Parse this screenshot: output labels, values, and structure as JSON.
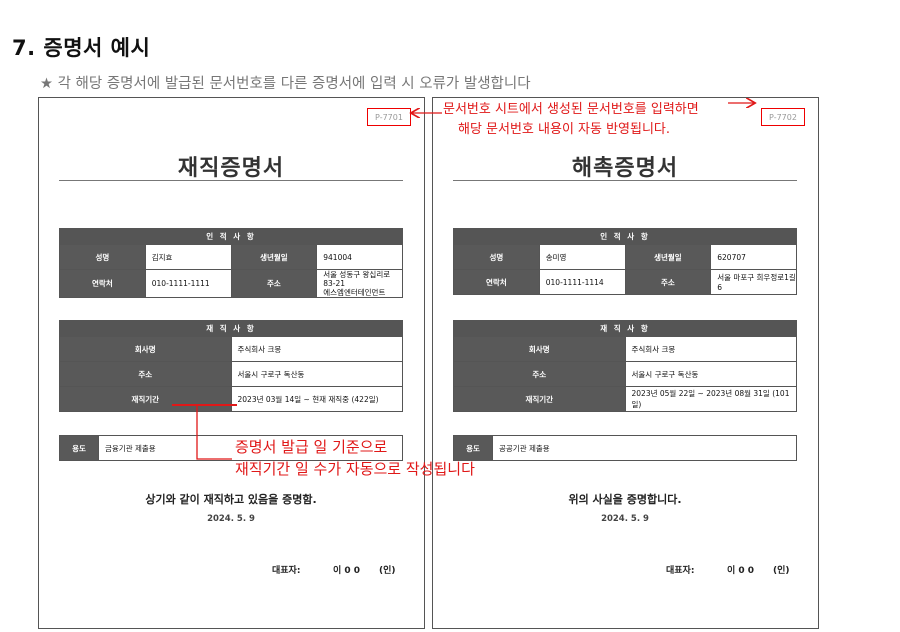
{
  "heading": "7. 증명서 예시",
  "subtitle": "★ 각 해당 증명서에 발급된 문서번호를 다른 증명서에 입력 시 오류가 발생합니다",
  "annotation_top": {
    "line1": "문서번호 시트에서 생성된 문서번호를 입력하면",
    "line2": "해당 문서번호 내용이 자동 반영됩니다."
  },
  "annotation_mid": {
    "line1": "증명서 발급 일 기준으로",
    "line2": "재직기간 일 수가 자동으로 작성됩니다"
  },
  "colors": {
    "accent_red": "#e01818",
    "header_gray": "#595959"
  },
  "left_doc": {
    "doc_no": "P-7701",
    "title": "재직증명서",
    "personal": {
      "header": "인 적 사 항",
      "name_label": "성명",
      "name": "김지효",
      "birth_label": "생년월일",
      "birth": "941004",
      "phone_label": "연락처",
      "phone": "010-1111-1111",
      "address_label": "주소",
      "address_line1": "서울 성동구 왕십리로 83-21",
      "address_line2": "에스엠엔터테인먼트"
    },
    "employment": {
      "header": "재 직 사 항",
      "company_label": "회사명",
      "company": "주식회사 크몽",
      "address_label": "주소",
      "address": "서울시 구로구 독산동",
      "period_label": "재직기간",
      "period_start": "2023년 03월 14일 ~ ",
      "period_end": "현재 재직중 (422일)"
    },
    "purpose_label": "용도",
    "purpose": "금융기관 제출용",
    "statement": "상기와 같이 재직하고 있음을 증명함.",
    "date": "2024. 5. 9",
    "rep_label": "대표자:",
    "rep_name": "이 0 0",
    "seal": "(인)"
  },
  "right_doc": {
    "doc_no": "P-7702",
    "title": "해촉증명서",
    "personal": {
      "header": "인 적 사 항",
      "name_label": "성명",
      "name": "송미영",
      "birth_label": "생년월일",
      "birth": "620707",
      "phone_label": "연락처",
      "phone": "010-1111-1114",
      "address_label": "주소",
      "address_line1": "서울 마포구 희우정로1길 6"
    },
    "employment": {
      "header": "재 직 사 항",
      "company_label": "회사명",
      "company": "주식회사 크몽",
      "address_label": "주소",
      "address": "서울시 구로구 독산동",
      "period_label": "재직기간",
      "period": "2023년 05월 22일 ~ 2023년 08월 31일 (101일)"
    },
    "purpose_label": "용도",
    "purpose": "공공기관 제출용",
    "statement": "위의 사실을 증명합니다.",
    "date": "2024. 5. 9",
    "rep_label": "대표자:",
    "rep_name": "이 0 0",
    "seal": "(인)"
  }
}
